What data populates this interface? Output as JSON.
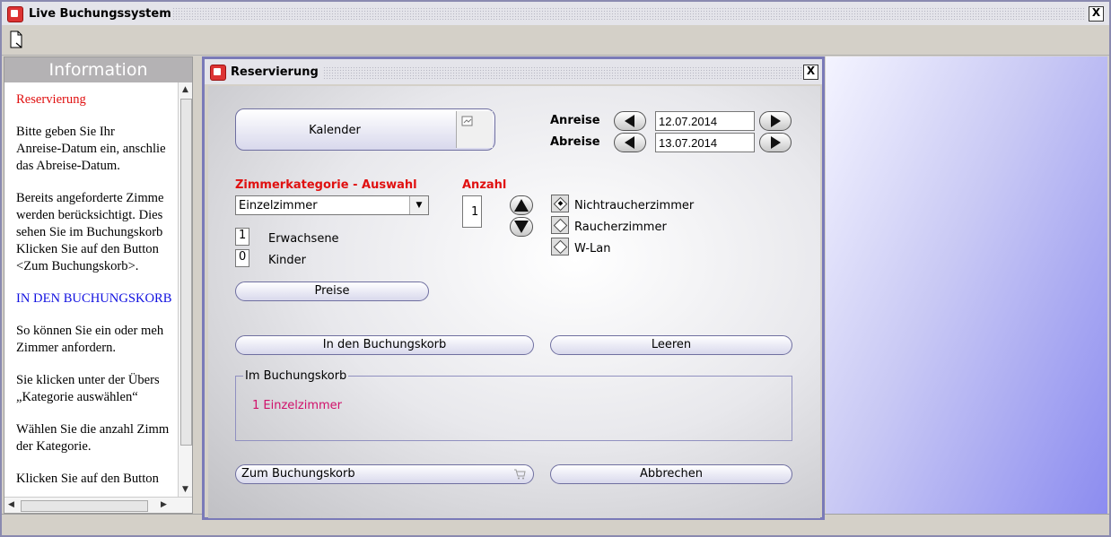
{
  "app": {
    "title": "Live Buchungssystem",
    "close_label": "X"
  },
  "info": {
    "heading": "Information",
    "paragraphs": [
      {
        "text": "Reservierung",
        "color": "red"
      },
      {
        "text": "Bitte geben Sie Ihr\nAnreise-Datum ein, anschlie\ndas Abreise-Datum."
      },
      {
        "text": "Bereits angeforderte Zimme\nwerden berücksichtigt. Dies\nsehen Sie im Buchungskorb\nKlicken Sie auf den Button\n<Zum Buchungskorb>."
      },
      {
        "text": "IN DEN BUCHUNGSKORB",
        "color": "blue"
      },
      {
        "text": "So können Sie ein oder meh\nZimmer anfordern."
      },
      {
        "text": "Sie klicken unter der Übers\n„Kategorie auswählen“"
      },
      {
        "text": "Wählen Sie die anzahl Zimm\nder Kategorie."
      },
      {
        "text": "Klicken Sie auf den Button"
      }
    ]
  },
  "dialog": {
    "title": "Reservierung",
    "close_label": "X",
    "kalender_label": "Kalender",
    "anreise": {
      "label": "Anreise",
      "value": "12.07.2014"
    },
    "abreise": {
      "label": "Abreise",
      "value": "13.07.2014"
    },
    "kategorie_label": "Zimmerkategorie - Auswahl",
    "kategorie_value": "Einzelzimmer",
    "anzahl_label": "Anzahl",
    "anzahl_value": "1",
    "erwachsene": {
      "value": "1",
      "label": "Erwachsene"
    },
    "kinder": {
      "value": "0",
      "label": "Kinder"
    },
    "options": [
      {
        "label": "Nichtraucherzimmer",
        "checked": true
      },
      {
        "label": "Raucherzimmer",
        "checked": false
      },
      {
        "label": "W-Lan",
        "checked": false
      }
    ],
    "preise_label": "Preise",
    "in_korb_label": "In den Buchungskorb",
    "leeren_label": "Leeren",
    "korb_legend": "Im Buchungskorb",
    "korb_items": [
      "1 Einzelzimmer"
    ],
    "zum_korb_label": "Zum Buchungskorb",
    "abbrechen_label": "Abbrechen",
    "colors": {
      "accent_red": "#e01010",
      "korb_item": "#d0106a",
      "link_blue": "#1010e0"
    }
  }
}
